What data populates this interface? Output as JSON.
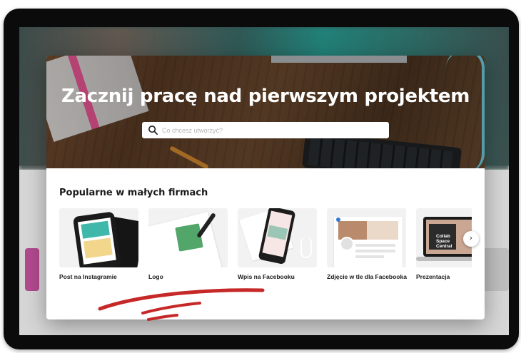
{
  "hero": {
    "title": "Zacznij pracę nad pierwszym projektem",
    "search_placeholder": "Co chcesz utworzyć?"
  },
  "section": {
    "title": "Popularne w małych firmach"
  },
  "cards": [
    {
      "label": "Post na Instagramie"
    },
    {
      "label": "Logo"
    },
    {
      "label": "Wpis na Facebooku"
    },
    {
      "label": "Zdjęcie w tle dla Facebooka"
    },
    {
      "label": "Prezentacja"
    }
  ],
  "thumb_text": {
    "presentation_slide": "Collab Space Central"
  },
  "icons": {
    "search": "search-icon",
    "next": "chevron-right-icon"
  },
  "colors": {
    "accent_red": "#c62828"
  }
}
